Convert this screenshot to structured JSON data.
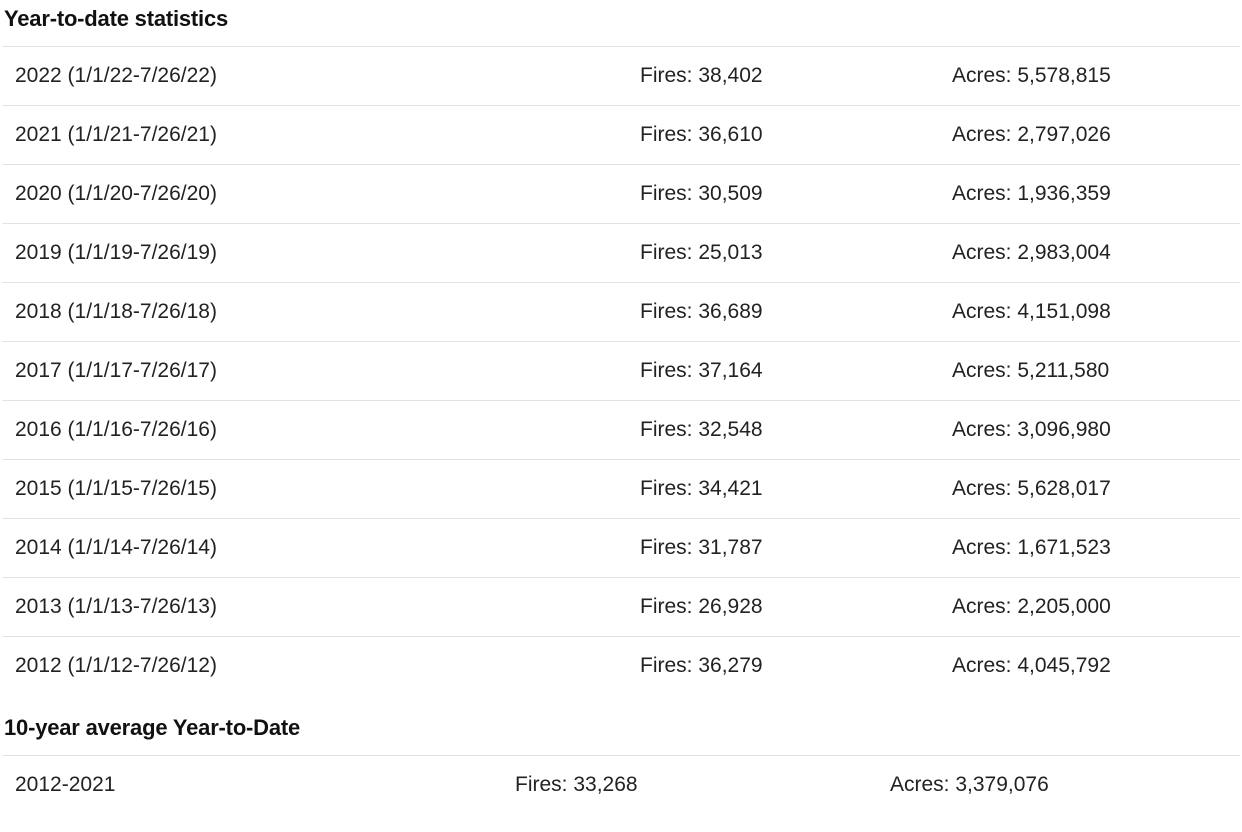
{
  "ytd": {
    "title": "Year-to-date statistics",
    "rows": [
      {
        "period": "2022 (1/1/22-7/26/22)",
        "fires": "Fires: 38,402",
        "acres": "Acres: 5,578,815"
      },
      {
        "period": "2021 (1/1/21-7/26/21)",
        "fires": "Fires: 36,610",
        "acres": "Acres: 2,797,026"
      },
      {
        "period": "2020 (1/1/20-7/26/20)",
        "fires": "Fires: 30,509",
        "acres": "Acres: 1,936,359"
      },
      {
        "period": "2019 (1/1/19-7/26/19)",
        "fires": "Fires: 25,013",
        "acres": "Acres: 2,983,004"
      },
      {
        "period": "2018 (1/1/18-7/26/18)",
        "fires": "Fires: 36,689",
        "acres": "Acres: 4,151,098"
      },
      {
        "period": "2017 (1/1/17-7/26/17)",
        "fires": "Fires: 37,164",
        "acres": "Acres: 5,211,580"
      },
      {
        "period": "2016 (1/1/16-7/26/16)",
        "fires": "Fires: 32,548",
        "acres": "Acres: 3,096,980"
      },
      {
        "period": "2015 (1/1/15-7/26/15)",
        "fires": "Fires: 34,421",
        "acres": "Acres: 5,628,017"
      },
      {
        "period": "2014 (1/1/14-7/26/14)",
        "fires": "Fires: 31,787",
        "acres": "Acres: 1,671,523"
      },
      {
        "period": "2013 (1/1/13-7/26/13)",
        "fires": "Fires: 26,928",
        "acres": "Acres: 2,205,000"
      },
      {
        "period": "2012 (1/1/12-7/26/12)",
        "fires": "Fires: 36,279",
        "acres": "Acres: 4,045,792"
      }
    ]
  },
  "average": {
    "title": "10-year average Year-to-Date",
    "rows": [
      {
        "period": "2012-2021",
        "fires": "Fires: 33,268",
        "acres": "Acres: 3,379,076"
      }
    ]
  }
}
